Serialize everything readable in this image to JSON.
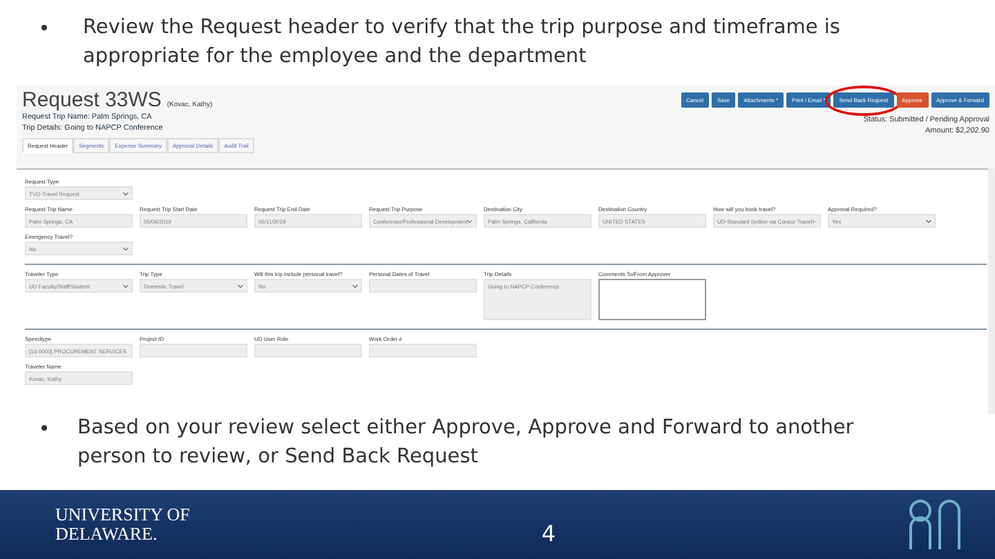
{
  "bullets_top": [
    {
      "text": "Review the Request header to verify that the trip purpose and timeframe is appropriate for the employee and the department"
    }
  ],
  "screen": {
    "title": "Request 33WS",
    "subtitle": "(Kovac, Kathy)",
    "trip_name": "Request Trip Name: Palm Springs, CA",
    "trip_details": "Trip Details: Going to NAPCP Conference",
    "buttons": [
      {
        "label": "Cancel",
        "kind": "primary",
        "highlighted": false
      },
      {
        "label": "Save",
        "kind": "primary",
        "highlighted": false
      },
      {
        "label": "Attachments *",
        "kind": "primary",
        "highlighted": false
      },
      {
        "label": "Print / Email *",
        "kind": "primary",
        "highlighted": false
      },
      {
        "label": "Send Back Request",
        "kind": "primary",
        "highlighted": true
      },
      {
        "label": "Approve",
        "kind": "warning",
        "highlighted": false
      },
      {
        "label": "Approve & Forward",
        "kind": "primary",
        "highlighted": false
      }
    ],
    "status": "Status: Submitted / Pending Approval",
    "amount": "Amount: $2,202.90",
    "tabs": [
      {
        "label": "Request Header",
        "selected": true
      },
      {
        "label": "Segments",
        "selected": false
      },
      {
        "label": "Expense Summary",
        "selected": false
      },
      {
        "label": "Approval Details",
        "selected": false
      },
      {
        "label": "Audit Trail",
        "selected": false
      }
    ],
    "sections": [
      {
        "rows": [
          [
            {
              "label": "Request Type",
              "value": "TVO-Travel Request",
              "kind": "select"
            }
          ],
          [
            {
              "label": "Request Trip Name",
              "value": "Palm Springs, CA",
              "kind": "text"
            },
            {
              "label": "Request Trip Start Date",
              "value": "05/06/2019",
              "kind": "date"
            },
            {
              "label": "Request Trip End Date",
              "value": "06/11/2019",
              "kind": "text"
            },
            {
              "label": "Request Trip Purpose",
              "value": "Conference/Professional Development",
              "kind": "select"
            },
            {
              "label": "Destination City",
              "value": "Palm Springs, California",
              "kind": "text"
            },
            {
              "label": "Destination Country",
              "value": "UNITED STATES",
              "kind": "text"
            },
            {
              "label": "How will you book travel?",
              "value": "UD-Standard (online via Concur Travel)",
              "kind": "select"
            },
            {
              "label": "Approval Required?",
              "value": "Yes",
              "kind": "select"
            }
          ],
          [
            {
              "label": "Emergency Travel?",
              "value": "No",
              "kind": "select"
            }
          ]
        ]
      },
      {
        "rows": [
          [
            {
              "label": "Traveler Type",
              "value": "UD Faculty/Staff/Student",
              "kind": "select"
            },
            {
              "label": "Trip Type",
              "value": "Domestic Travel",
              "kind": "select"
            },
            {
              "label": "Will this trip include personal travel?",
              "value": "No",
              "kind": "select"
            },
            {
              "label": "Personal Dates of Travel",
              "kind": "text"
            },
            {
              "label": "Trip Details",
              "value": "Going to NAPCP Conference",
              "kind": "textarea"
            },
            {
              "label": "Comments To/From Approver",
              "kind": "note"
            }
          ]
        ]
      },
      {
        "rows": [
          [
            {
              "label": "Speedtype",
              "value": "[16-0000] PROCUREMENT SERVICES",
              "kind": "text"
            },
            {
              "label": "Project ID",
              "kind": "text"
            },
            {
              "label": "UD User Role",
              "kind": "text"
            },
            {
              "label": "Work Order #",
              "kind": "text"
            }
          ],
          [
            {
              "label": "Traveler Name",
              "value": "Kovac, Kathy",
              "kind": "text"
            }
          ]
        ]
      }
    ]
  },
  "bullets_bottom": [
    {
      "text": "Based on your review select either Approve, Approve and Forward to another person to review, or Send Back Request"
    }
  ],
  "footer": {
    "logo": "UNIVERSITY OF DELAWARE.",
    "page_number": "4"
  }
}
